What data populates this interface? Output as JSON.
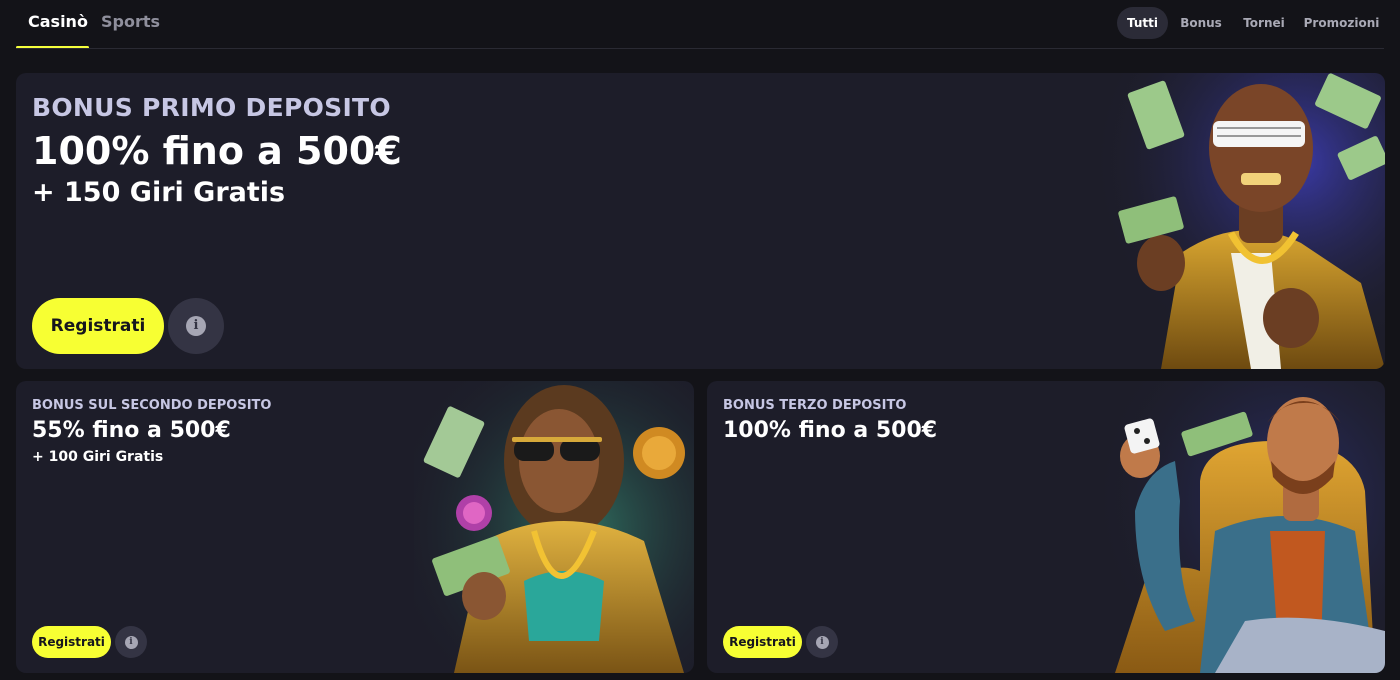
{
  "nav": {
    "main_tabs": [
      {
        "label": "Casinò",
        "active": true
      },
      {
        "label": "Sports",
        "active": false
      }
    ],
    "filters": [
      {
        "label": "Tutti",
        "active": true
      },
      {
        "label": "Bonus",
        "active": false
      },
      {
        "label": "Tornei",
        "active": false
      },
      {
        "label": "Promozioni",
        "active": false
      }
    ]
  },
  "promos": [
    {
      "eyebrow": "BONUS PRIMO DEPOSITO",
      "amount": "100% fino a 500€",
      "extra": "+ 150 Giri Gratis",
      "cta_label": "Registrati",
      "info_icon": "info-icon"
    },
    {
      "eyebrow": "BONUS SUL SECONDO DEPOSITO",
      "amount": "55% fino a 500€",
      "extra": "+ 100 Giri Gratis",
      "cta_label": "Registrati",
      "info_icon": "info-icon"
    },
    {
      "eyebrow": "BONUS TERZO DEPOSITO",
      "amount": "100% fino a 500€",
      "cta_label": "Registrati",
      "info_icon": "info-icon"
    }
  ],
  "colors": {
    "background": "#131318",
    "card": "#1d1d29",
    "accent": "#f7ff33",
    "eyebrow": "#c7c7e4",
    "muted": "#8f8f9c"
  }
}
